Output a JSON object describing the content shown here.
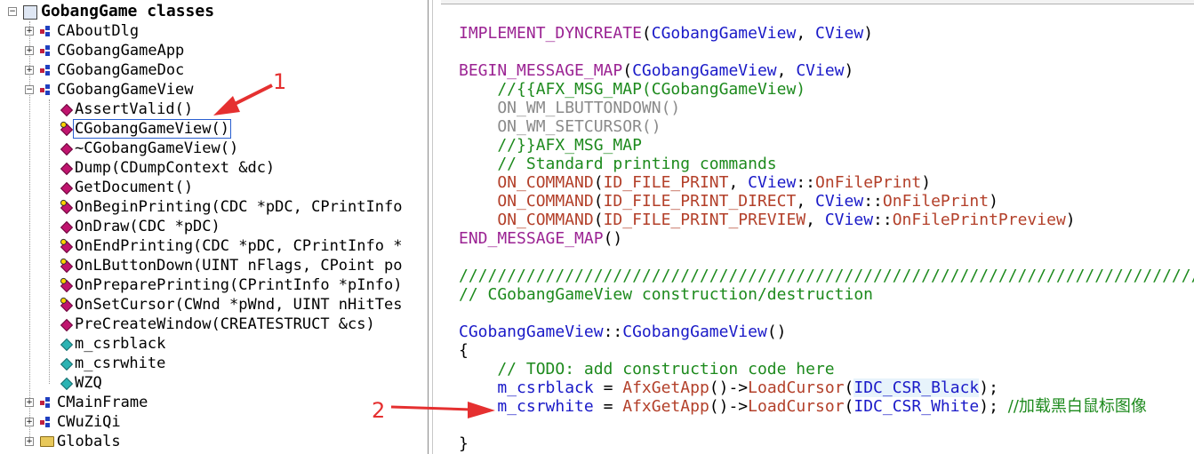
{
  "tree": {
    "root": "GobangGame classes",
    "classes": [
      {
        "name": "CAboutDlg"
      },
      {
        "name": "CGobangGameApp"
      },
      {
        "name": "CGobangGameDoc"
      },
      {
        "name": "CGobangGameView"
      }
    ],
    "members": [
      {
        "label": "AssertValid()",
        "kind": "func"
      },
      {
        "label": "CGobangGameView()",
        "kind": "func-key"
      },
      {
        "label": "~CGobangGameView()",
        "kind": "func"
      },
      {
        "label": "Dump(CDumpContext &dc)",
        "kind": "func"
      },
      {
        "label": "GetDocument()",
        "kind": "func"
      },
      {
        "label": "OnBeginPrinting(CDC *pDC, CPrintInfo",
        "kind": "func-key"
      },
      {
        "label": "OnDraw(CDC *pDC)",
        "kind": "func"
      },
      {
        "label": "OnEndPrinting(CDC *pDC, CPrintInfo *",
        "kind": "func-key"
      },
      {
        "label": "OnLButtonDown(UINT nFlags, CPoint po",
        "kind": "func-key"
      },
      {
        "label": "OnPreparePrinting(CPrintInfo *pInfo)",
        "kind": "func-key"
      },
      {
        "label": "OnSetCursor(CWnd *pWnd, UINT nHitTes",
        "kind": "func-key"
      },
      {
        "label": "PreCreateWindow(CREATESTRUCT &cs)",
        "kind": "func"
      },
      {
        "label": "m_csrblack",
        "kind": "var"
      },
      {
        "label": "m_csrwhite",
        "kind": "var"
      },
      {
        "label": "WZQ",
        "kind": "var"
      }
    ],
    "after": [
      {
        "name": "CMainFrame"
      },
      {
        "name": "CWuZiQi"
      },
      {
        "name": "Globals"
      }
    ]
  },
  "code": {
    "l1": [
      "IMPLEMENT_DYNCREATE",
      "(",
      "CGobangGameView",
      ", ",
      "CView",
      ")"
    ],
    "l2": [
      "BEGIN_MESSAGE_MAP",
      "(",
      "CGobangGameView",
      ", ",
      "CView",
      ")"
    ],
    "l3": "    //{{AFX_MSG_MAP(CGobangGameView)",
    "l4": "    ON_WM_LBUTTONDOWN()",
    "l5": "    ON_WM_SETCURSOR()",
    "l6": "    //}}AFX_MSG_MAP",
    "l7": "    // Standard printing commands",
    "l8": [
      "    ",
      "ON_COMMAND",
      "(",
      "ID_FILE_PRINT",
      ", ",
      "CView",
      "::",
      "OnFilePrint",
      ")"
    ],
    "l9": [
      "    ",
      "ON_COMMAND",
      "(",
      "ID_FILE_PRINT_DIRECT",
      ", ",
      "CView",
      "::",
      "OnFilePrint",
      ")"
    ],
    "l10": [
      "    ",
      "ON_COMMAND",
      "(",
      "ID_FILE_PRINT_PREVIEW",
      ", ",
      "CView",
      "::",
      "OnFilePrintPreview",
      ")"
    ],
    "l11": [
      "END_MESSAGE_MAP",
      "()"
    ],
    "l12": "///////////////////////////////////////////////////////////////////////////////",
    "l13": "// CGobangGameView construction/destruction",
    "l14": [
      "CGobangGameView",
      "::",
      "CGobangGameView",
      "()"
    ],
    "l15": "{",
    "l16": "    // TODO: add construction code here",
    "l17": [
      "    ",
      "m_csrblack",
      " = ",
      "AfxGetApp",
      "()->",
      "LoadCursor",
      "(",
      "IDC_CSR_Black",
      ");"
    ],
    "l18": [
      "    ",
      "m_csrwhite",
      " = ",
      "AfxGetApp",
      "()->",
      "LoadCursor",
      "(",
      "IDC_CSR_White",
      "); ",
      "//加载黑白鼠标图像"
    ],
    "l19": "}"
  },
  "annotations": {
    "one": "1",
    "two": "2"
  },
  "colors": {
    "arrow": "#e53030",
    "macro": "#9b2393",
    "identifier": "#1a1ac8",
    "function": "#b3402a",
    "comment": "#1d8a1d"
  }
}
